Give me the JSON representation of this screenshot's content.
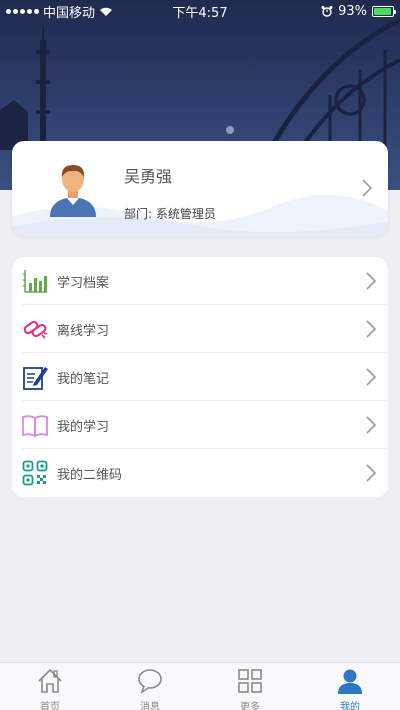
{
  "status_bar": {
    "carrier": "中国移动",
    "time": "下午4:57",
    "battery_percent": "93%",
    "battery_level": 0.93,
    "signal_bars": 5
  },
  "profile": {
    "name": "吴勇强",
    "department_label": "部门:",
    "department_value": "系统管理员"
  },
  "menu": {
    "items": [
      {
        "label": "学习档案",
        "icon": "bar-chart-icon",
        "color": "#6aa84f"
      },
      {
        "label": "离线学习",
        "icon": "offline-link-icon",
        "color": "#e0307a"
      },
      {
        "label": "我的笔记",
        "icon": "notebook-pen-icon",
        "color": "#1f3f94"
      },
      {
        "label": "我的学习",
        "icon": "open-book-icon",
        "color": "#d98be0"
      },
      {
        "label": "我的二维码",
        "icon": "qr-code-icon",
        "color": "#16a085"
      }
    ]
  },
  "tabbar": {
    "tabs": [
      {
        "label": "首页",
        "icon": "home-icon"
      },
      {
        "label": "消息",
        "icon": "message-icon"
      },
      {
        "label": "更多",
        "icon": "grid-icon"
      },
      {
        "label": "我的",
        "icon": "person-icon",
        "active": true
      }
    ],
    "active_color": "#2d78c4"
  }
}
